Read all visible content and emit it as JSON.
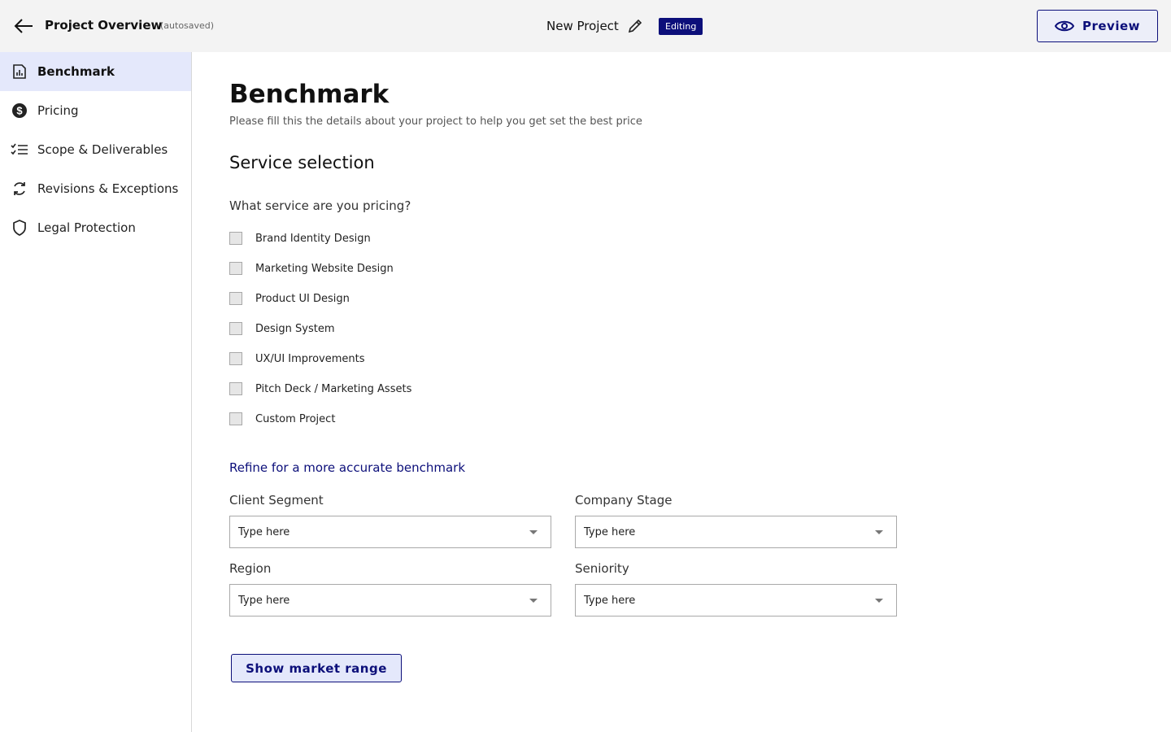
{
  "header": {
    "title": "Project Overview",
    "autosave_status": "(autosaved)",
    "project_name": "New Project",
    "mode_badge": "Editing",
    "preview_label": "Preview",
    "accent_color": "#0c0f7a"
  },
  "sidebar": {
    "items": [
      {
        "label": "Benchmark",
        "icon": "bar-chart-icon",
        "active": true
      },
      {
        "label": "Pricing",
        "icon": "dollar-circle-icon",
        "active": false
      },
      {
        "label": "Scope & Deliverables",
        "icon": "checklist-icon",
        "active": false
      },
      {
        "label": "Revisions & Exceptions",
        "icon": "refresh-icon",
        "active": false
      },
      {
        "label": "Legal Protection",
        "icon": "shield-icon",
        "active": false
      }
    ]
  },
  "main": {
    "heading": "Benchmark",
    "subheading": "Please fill this the details about your project to help you get set the best price",
    "section_title": "Service selection",
    "question": "What service are you pricing?",
    "services": [
      {
        "label": "Brand Identity Design",
        "checked": false
      },
      {
        "label": "Marketing Website Design",
        "checked": false
      },
      {
        "label": "Product UI Design",
        "checked": false
      },
      {
        "label": "Design System",
        "checked": false
      },
      {
        "label": "UX/UI Improvements",
        "checked": false
      },
      {
        "label": "Pitch Deck / Marketing Assets",
        "checked": false
      },
      {
        "label": "Custom Project",
        "checked": false
      }
    ],
    "refine_link": "Refine for a more accurate benchmark",
    "fields": {
      "client_segment": {
        "label": "Client Segment",
        "value": "Type here"
      },
      "company_stage": {
        "label": "Company Stage",
        "value": "Type here"
      },
      "region": {
        "label": "Region",
        "value": "Type here"
      },
      "seniority": {
        "label": "Seniority",
        "value": "Type here"
      }
    },
    "submit_label": "Show market range"
  }
}
